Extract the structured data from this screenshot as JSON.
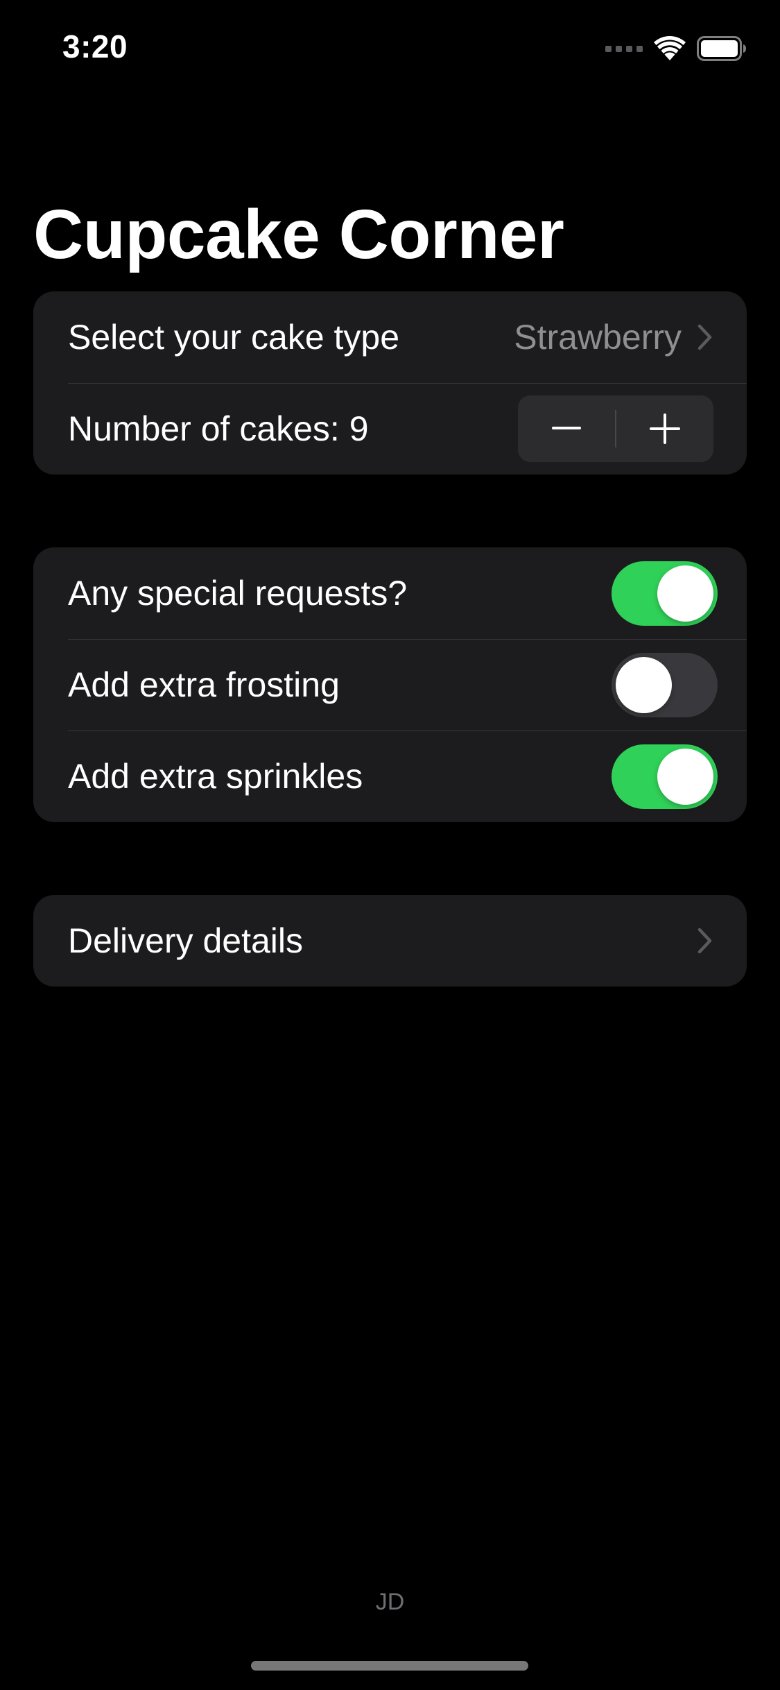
{
  "status_bar": {
    "time": "3:20"
  },
  "page": {
    "title": "Cupcake Corner"
  },
  "order_section": {
    "cake_type_label": "Select your cake type",
    "cake_type_value": "Strawberry",
    "quantity_label": "Number of cakes: 9",
    "quantity": 9
  },
  "options_section": {
    "special_requests": {
      "label": "Any special requests?",
      "on": true
    },
    "extra_frosting": {
      "label": "Add extra frosting",
      "on": false
    },
    "extra_sprinkles": {
      "label": "Add extra sprinkles",
      "on": true
    }
  },
  "delivery_section": {
    "label": "Delivery details"
  },
  "footer": {
    "initials": "JD"
  },
  "colors": {
    "background": "#000000",
    "cell": "#1c1c1e",
    "toggle_on": "#30d158",
    "toggle_off": "#39393d",
    "secondary_text": "#8e8e93"
  },
  "icons": {
    "chevron": "chevron-right-icon",
    "minus": "minus-icon",
    "plus": "plus-icon",
    "wifi": "wifi-icon",
    "battery": "battery-icon",
    "signal": "cellular-signal-icon"
  }
}
